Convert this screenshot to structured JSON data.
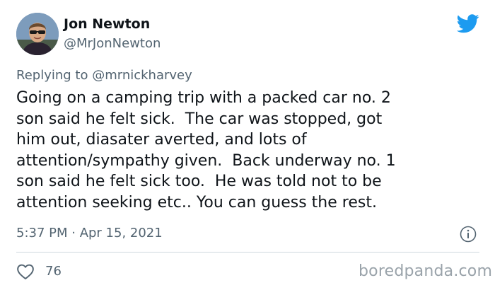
{
  "author": {
    "display_name": "Jon Newton",
    "handle": "@MrJonNewton"
  },
  "reply": {
    "prefix": "Replying to ",
    "mention": "@mrnickharvey"
  },
  "tweet": {
    "lines": [
      "Going on a camping trip with a packed car no. 2",
      "son said he felt sick.  The car was stopped, got",
      "him out, diasater averted, and lots of",
      "attention/sympathy given.  Back underway no. 1",
      "son said he felt sick too.  He was told not to be",
      "attention seeking etc.. You can guess the rest."
    ],
    "timestamp": "5:37 PM · Apr 15, 2021"
  },
  "actions": {
    "like_count": "76"
  },
  "watermark": "boredpanda.com",
  "icons": {
    "brand": "twitter-bird-icon",
    "info": "info-icon",
    "like": "heart-icon"
  },
  "colors": {
    "brand_blue": "#1d9bf0",
    "text_primary": "#0f1419",
    "text_secondary": "#536471",
    "divider": "#cfd9de"
  }
}
